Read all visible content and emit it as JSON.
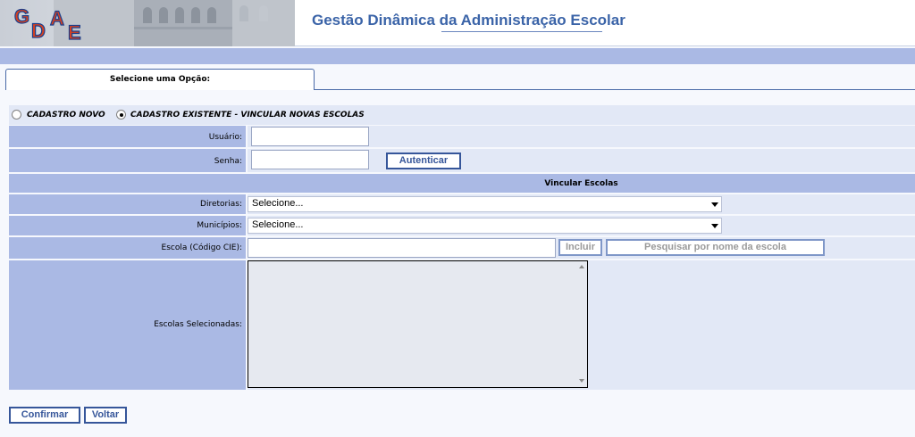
{
  "header": {
    "logo_letters": [
      "G",
      "D",
      "A",
      "E"
    ],
    "title": "Gestão Dinâmica da Administração Escolar"
  },
  "tab": {
    "label": "Selecione uma Opção:"
  },
  "options": [
    {
      "label": "CADASTRO NOVO",
      "checked": false
    },
    {
      "label": "CADASTRO EXISTENTE - VINCULAR NOVAS ESCOLAS",
      "checked": true
    }
  ],
  "auth": {
    "usuario_label": "Usuário:",
    "usuario_value": "",
    "senha_label": "Senha:",
    "senha_value": "",
    "autenticar_label": "Autenticar"
  },
  "vincular": {
    "title": "Vincular Escolas",
    "diretorias_label": "Diretorias:",
    "diretorias_value": "Selecione...",
    "municipios_label": "Municípios:",
    "municipios_value": "Selecione...",
    "escola_label": "Escola (Código CIE):",
    "escola_value": "",
    "incluir_label": "Incluir",
    "pesquisar_label": "Pesquisar por nome da escola",
    "selecionadas_label": "Escolas Selecionadas:",
    "selecionadas_items": []
  },
  "footer": {
    "confirmar_label": "Confirmar",
    "voltar_label": "Voltar"
  },
  "colors": {
    "accent": "#36569a",
    "title_blue": "#3b64a8",
    "label_cell": "#aab9e4",
    "field_cell": "#e2e8f6",
    "logo_red": "#d9411e"
  }
}
